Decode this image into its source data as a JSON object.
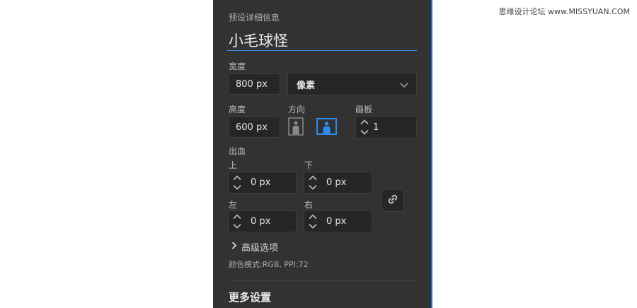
{
  "watermark": "思缘设计论坛 www.MISSYUAN.COM",
  "panel": {
    "section_title": "预设详细信息",
    "preset_name": "小毛球怪",
    "width": {
      "label": "宽度",
      "value": "800 px"
    },
    "unit": {
      "selected": "像素"
    },
    "height": {
      "label": "高度",
      "value": "600 px"
    },
    "orientation": {
      "label": "方向",
      "options": [
        "portrait",
        "landscape"
      ],
      "selected": "landscape"
    },
    "artboard": {
      "label": "画板",
      "value": "1"
    },
    "bleed": {
      "label": "出血",
      "top": {
        "label": "上",
        "value": "0 px"
      },
      "bottom": {
        "label": "下",
        "value": "0 px"
      },
      "left": {
        "label": "左",
        "value": "0 px"
      },
      "right": {
        "label": "右",
        "value": "0 px"
      }
    },
    "advanced": "高级选项",
    "color_mode": "颜色模式:RGB, PPI:72",
    "more_settings": "更多设置"
  },
  "icons": {
    "dropdown": "chevron-down-icon",
    "spinner": "spinner-arrows-icon",
    "link": "link-icon",
    "expand": "chevron-right-icon",
    "portrait": "portrait-orientation-icon",
    "landscape": "landscape-orientation-icon"
  },
  "colors": {
    "panel_bg": "#323232",
    "field_bg": "#262626",
    "accent": "#3a8ce8",
    "selected_orientation": "#2d8ceb"
  }
}
